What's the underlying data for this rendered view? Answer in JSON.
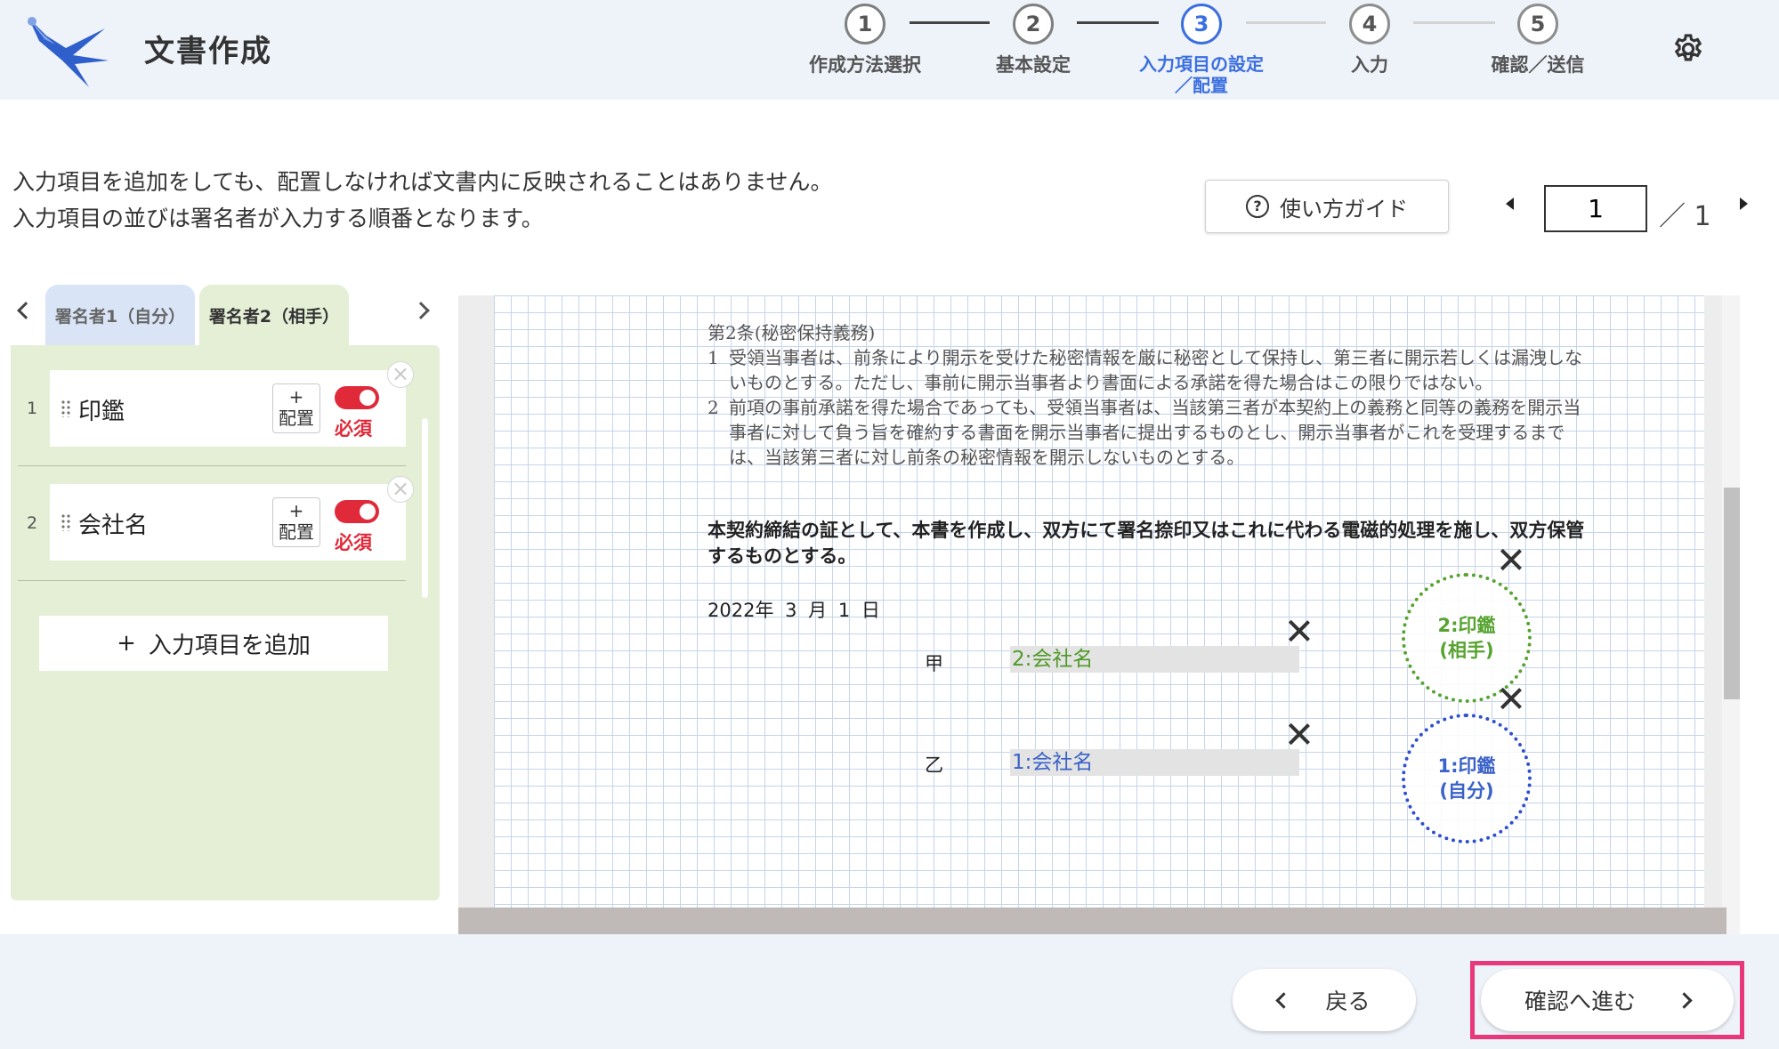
{
  "header": {
    "app_title": "文書作成",
    "steps": [
      {
        "number": "1",
        "label": "作成方法選択",
        "state": "done"
      },
      {
        "number": "2",
        "label": "基本設定",
        "state": "done"
      },
      {
        "number": "3",
        "label": "入力項目の設定\n／配置",
        "state": "active"
      },
      {
        "number": "4",
        "label": "入力",
        "state": "pending"
      },
      {
        "number": "5",
        "label": "確認／送信",
        "state": "pending"
      }
    ],
    "settings_icon": "gear-icon"
  },
  "instructions": {
    "line1": "入力項目を追加をしても、配置しなければ文書内に反映されることはありません。",
    "line2": "入力項目の並びは署名者が入力する順番となります。"
  },
  "guide_button": {
    "label": "使い方ガイド",
    "icon": "help-circle-icon"
  },
  "pagination": {
    "current": "1",
    "total": "1",
    "separator": "／"
  },
  "signer_tabs": [
    {
      "label": "署名者1（自分）",
      "selected": false
    },
    {
      "label": "署名者2（相手）",
      "selected": true
    }
  ],
  "fields": [
    {
      "number": "1",
      "name": "印鑑",
      "place_icon": "+",
      "place_label": "配置",
      "required_label": "必須",
      "required": true
    },
    {
      "number": "2",
      "name": "会社名",
      "place_icon": "+",
      "place_label": "配置",
      "required_label": "必須",
      "required": true
    }
  ],
  "add_field_button": {
    "icon": "+",
    "label": "入力項目を追加"
  },
  "document": {
    "article_title": "第2条(秘密保持義務)",
    "clause1_num": "1",
    "clause1": "受領当事者は、前条により開示を受けた秘密情報を厳に秘密として保持し、第三者に開示若しくは漏洩しないものとする。ただし、事前に開示当事者より書面による承諾を得た場合はこの限りではない。",
    "clause2_num": "2",
    "clause2": "前項の事前承諾を得た場合であっても、受領当事者は、当該第三者が本契約上の義務と同等の義務を開示当事者に対して負う旨を確約する書面を開示当事者に提出するものとし、開示当事者がこれを受理するまでは、当該第三者に対し前条の秘密情報を開示しないものとする。",
    "closing": "本契約締結の証として、本書を作成し、双方にて署名捺印又はこれに代わる電磁的処理を施し、双方保管するものとする。",
    "date": "2022年 3 月 1 日",
    "party_a_label": "甲",
    "party_a_field": "2:会社名",
    "party_b_label": "乙",
    "party_b_field": "1:会社名",
    "seal_a_line1": "2:印鑑",
    "seal_a_line2": "(相手)",
    "seal_b_line1": "1:印鑑",
    "seal_b_line2": "(自分)"
  },
  "footer": {
    "back_label": "戻る",
    "next_label": "確認へ進む"
  },
  "colors": {
    "active_step": "#3b6fe0",
    "required_red": "#e02a3a",
    "signer2_green": "#57a330",
    "signer1_blue": "#2f4fcf",
    "highlight_pink": "#e8377a"
  }
}
